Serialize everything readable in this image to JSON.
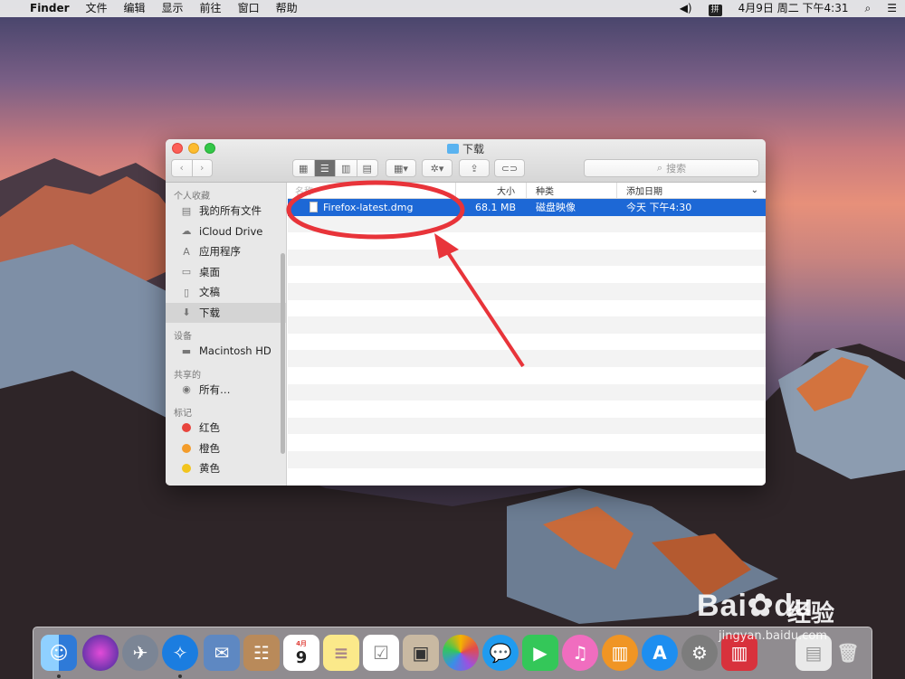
{
  "menubar": {
    "apple": "",
    "app": "Finder",
    "items": [
      "文件",
      "编辑",
      "显示",
      "前往",
      "窗口",
      "帮助"
    ],
    "volume_icon": "speaker-icon",
    "ime": "拼",
    "clock": "4月9日 周二 下午4:31",
    "search_icon": "spotlight-icon",
    "list_icon": "notification-center-icon"
  },
  "window": {
    "title": "下载",
    "search_placeholder": "搜索",
    "sidebar": {
      "sections": [
        {
          "header": "个人收藏",
          "items": [
            {
              "label": "我的所有文件",
              "icon": "all-files-icon"
            },
            {
              "label": "iCloud Drive",
              "icon": "cloud-icon"
            },
            {
              "label": "应用程序",
              "icon": "applications-icon"
            },
            {
              "label": "桌面",
              "icon": "desktop-icon"
            },
            {
              "label": "文稿",
              "icon": "documents-icon"
            },
            {
              "label": "下载",
              "icon": "downloads-icon",
              "selected": true
            }
          ]
        },
        {
          "header": "设备",
          "items": [
            {
              "label": "Macintosh HD",
              "icon": "hard-disk-icon"
            }
          ]
        },
        {
          "header": "共享的",
          "items": [
            {
              "label": "所有…",
              "icon": "network-icon"
            }
          ]
        },
        {
          "header": "标记",
          "items": [
            {
              "label": "红色",
              "color": "#e8443c"
            },
            {
              "label": "橙色",
              "color": "#f39c2a"
            },
            {
              "label": "黄色",
              "color": "#f2c41e"
            }
          ]
        }
      ]
    },
    "columns": {
      "name": "名称",
      "size": "大小",
      "kind": "种类",
      "date": "添加日期"
    },
    "files": [
      {
        "name": "Firefox-latest.dmg",
        "size": "68.1 MB",
        "kind": "磁盘映像",
        "date": "今天 下午4:30",
        "selected": true
      }
    ]
  },
  "colors": {
    "selection": "#1d68d6",
    "annotation": "#e8343a"
  },
  "dock": {
    "apps": [
      "finder-icon",
      "siri-icon",
      "launchpad-icon",
      "safari-icon",
      "mail-icon",
      "contacts-icon",
      "calendar-icon",
      "notes-icon",
      "reminders-icon",
      "photo-booth-icon",
      "photos-icon",
      "messages-icon",
      "facetime-icon",
      "itunes-icon",
      "ibooks-icon",
      "app-store-icon",
      "system-preferences-icon",
      "parallels-icon",
      "downloads-stack-icon",
      "trash-icon"
    ],
    "calendar_month": "4月",
    "calendar_day": "9"
  },
  "watermark": {
    "logo": "Bai",
    "logo_tail": "du",
    "text": "经验",
    "url": "jingyan.baidu.com"
  }
}
